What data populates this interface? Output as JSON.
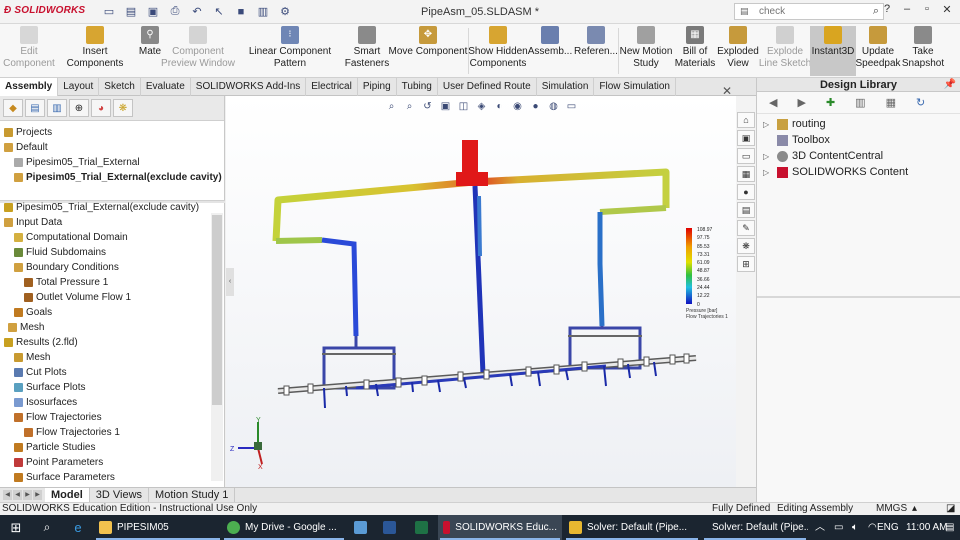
{
  "app": {
    "logo_text": "SOLIDWORKS",
    "document_title": "PipeAsm_05.SLDASM *",
    "search_placeholder": "check",
    "window_controls": [
      "?",
      "–",
      "▫",
      "✕"
    ]
  },
  "quick_access": {
    "icons": [
      "new-icon",
      "open-icon",
      "save-icon",
      "print-icon",
      "undo-icon",
      "select-icon",
      "rebuild-icon",
      "file-properties-icon",
      "options-icon"
    ]
  },
  "ribbon": {
    "buttons": [
      {
        "label": "Edit\nComponent",
        "enabled": false
      },
      {
        "label": "Insert Components",
        "enabled": true
      },
      {
        "label": "Mate",
        "enabled": true
      },
      {
        "label": "Component\nPreview Window",
        "enabled": false
      },
      {
        "label": "Linear Component Pattern",
        "enabled": true
      },
      {
        "label": "Smart\nFasteners",
        "enabled": true
      },
      {
        "label": "Move Component",
        "enabled": true
      },
      {
        "label": "Show Hidden\nComponents",
        "enabled": true
      },
      {
        "label": "Assemb...",
        "enabled": true
      },
      {
        "label": "Referen...",
        "enabled": true
      },
      {
        "label": "New Motion\nStudy",
        "enabled": true
      },
      {
        "label": "Bill of\nMaterials",
        "enabled": true
      },
      {
        "label": "Exploded\nView",
        "enabled": true
      },
      {
        "label": "Explode\nLine Sketch",
        "enabled": false
      },
      {
        "label": "Instant3D",
        "enabled": true
      },
      {
        "label": "Update\nSpeedpak",
        "enabled": true
      },
      {
        "label": "Take\nSnapshot",
        "enabled": true
      }
    ]
  },
  "command_tabs": [
    "Assembly",
    "Layout",
    "Sketch",
    "Evaluate",
    "SOLIDWORKS Add-Ins",
    "Electrical",
    "Piping",
    "Tubing",
    "User Defined Route",
    "Simulation",
    "Flow Simulation"
  ],
  "feature_manager": {
    "project_tree": [
      {
        "label": "Projects",
        "indent": 0,
        "bold": false
      },
      {
        "label": "Default",
        "indent": 0,
        "bold": false
      },
      {
        "label": "Pipesim05_Trial_External",
        "indent": 1,
        "bold": false
      },
      {
        "label": "Pipesim05_Trial_External(exclude cavity)",
        "indent": 1,
        "bold": true
      }
    ],
    "analysis_tree": [
      {
        "label": "Pipesim05_Trial_External(exclude cavity)",
        "indent": 0
      },
      {
        "label": "Input Data",
        "indent": 0
      },
      {
        "label": "Computational Domain",
        "indent": 1
      },
      {
        "label": "Fluid Subdomains",
        "indent": 1
      },
      {
        "label": "Boundary Conditions",
        "indent": 1
      },
      {
        "label": "Total Pressure 1",
        "indent": 2
      },
      {
        "label": "Outlet Volume Flow 1",
        "indent": 2
      },
      {
        "label": "Goals",
        "indent": 1
      },
      {
        "label": "Mesh",
        "indent": 1
      },
      {
        "label": "Results (2.fld)",
        "indent": 0
      },
      {
        "label": "Mesh",
        "indent": 1
      },
      {
        "label": "Cut Plots",
        "indent": 1
      },
      {
        "label": "Surface Plots",
        "indent": 1
      },
      {
        "label": "Isosurfaces",
        "indent": 1
      },
      {
        "label": "Flow Trajectories",
        "indent": 1
      },
      {
        "label": "Flow Trajectories 1",
        "indent": 2
      },
      {
        "label": "Particle Studies",
        "indent": 1
      },
      {
        "label": "Point Parameters",
        "indent": 1
      },
      {
        "label": "Surface Parameters",
        "indent": 1
      }
    ]
  },
  "bottom_tabs": [
    "Model",
    "3D Views",
    "Motion Study 1"
  ],
  "legend": {
    "values": [
      "108.97",
      "97.75",
      "85.53",
      "73.31",
      "61.09",
      "48.87",
      "36.66",
      "24.44",
      "12.22",
      "0"
    ],
    "caption_1": "Pressure [bar]",
    "caption_2": "Flow Trajectories 1"
  },
  "design_library": {
    "title": "Design Library",
    "items": [
      {
        "label": "routing",
        "expandable": true
      },
      {
        "label": "Toolbox",
        "expandable": false
      },
      {
        "label": "3D ContentCentral",
        "expandable": true
      },
      {
        "label": "SOLIDWORKS Content",
        "expandable": true
      }
    ]
  },
  "status_bar": {
    "left": "SOLIDWORKS Education Edition - Instructional Use Only",
    "state": "Fully Defined",
    "mode": "Editing Assembly",
    "units": "MMGS"
  },
  "taskbar": {
    "items": [
      {
        "label": "PIPESIM05",
        "color": "#f2c14e"
      },
      {
        "label": "My Drive - Google ...",
        "color": "#4caf50"
      },
      {
        "label": "",
        "color": "#5b9bd5"
      },
      {
        "label": "",
        "color": "#2b5797"
      },
      {
        "label": "",
        "color": "#1e7145"
      },
      {
        "label": "SOLIDWORKS Educ...",
        "color": "#c8102e"
      },
      {
        "label": "Solver: Default (Pipe...",
        "color": "#e8b730"
      },
      {
        "label": "Solver: Default (Pipe...",
        "color": "#e8b730"
      }
    ],
    "language": "ENG",
    "time": "11:00 AM"
  },
  "colors": {
    "accent": "#c8102e",
    "taskbar": "#1b2530",
    "pressure_high": "#e01010",
    "pressure_low": "#1020c0"
  }
}
